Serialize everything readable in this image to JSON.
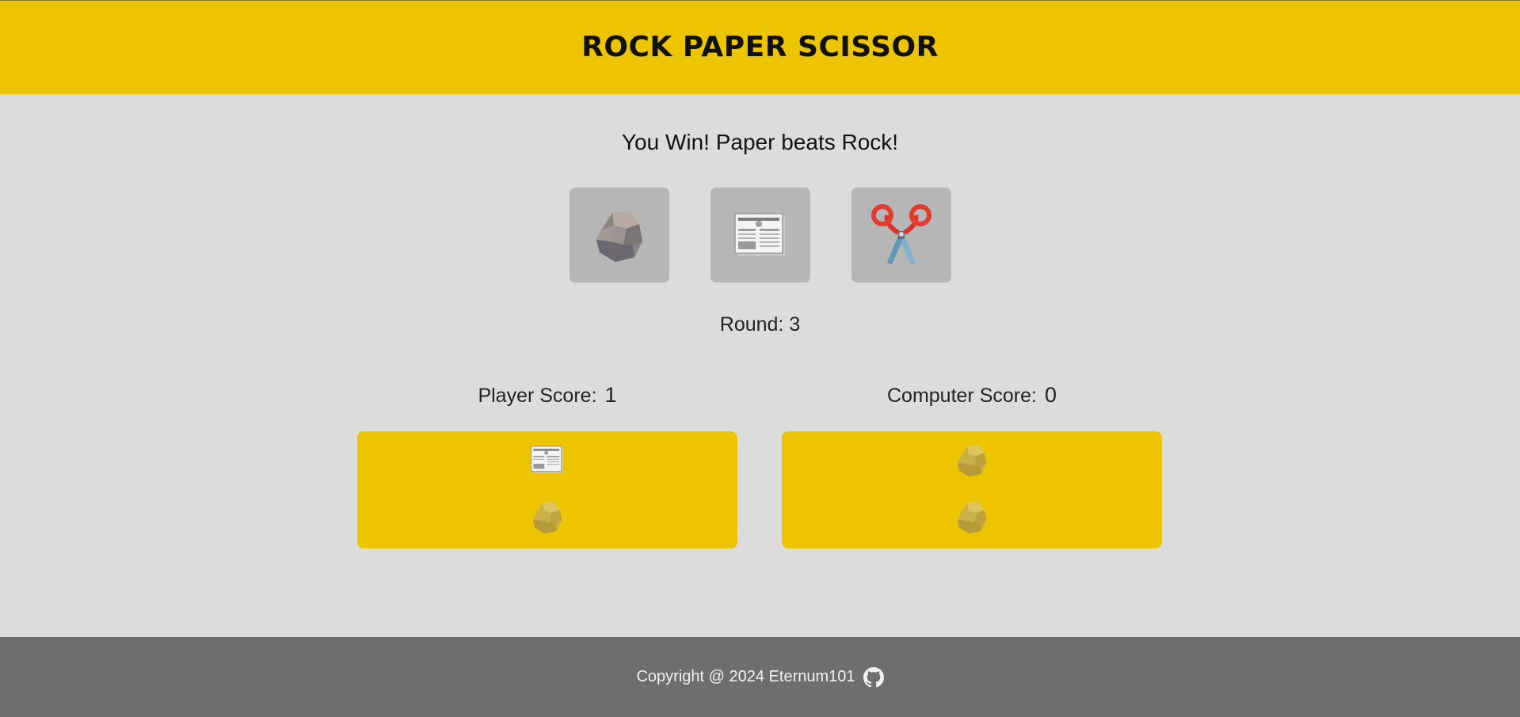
{
  "header": {
    "title": "ROCK PAPER SCISSOR"
  },
  "result": {
    "message": "You Win! Paper beats Rock!"
  },
  "choices": [
    {
      "name": "Rock",
      "icon": "rock-icon"
    },
    {
      "name": "Paper",
      "icon": "newspaper-icon"
    },
    {
      "name": "Scissor",
      "icon": "scissors-icon"
    }
  ],
  "round": {
    "text": "Round: 3"
  },
  "scores": {
    "player": {
      "label": "Player Score:",
      "value": "1"
    },
    "computer": {
      "label": "Computer Score:",
      "value": "0"
    }
  },
  "history": {
    "player": [
      "newspaper-icon",
      "rock-icon-faded"
    ],
    "computer": [
      "rock-icon-faded",
      "rock-icon-faded"
    ]
  },
  "footer": {
    "text": "Copyright @ 2024 Eternum101",
    "icon": "github-icon"
  },
  "colors": {
    "accent": "#ecc500",
    "background": "#dcdcdc",
    "tile": "#b6b6b6",
    "footer": "#6e6e6e"
  }
}
